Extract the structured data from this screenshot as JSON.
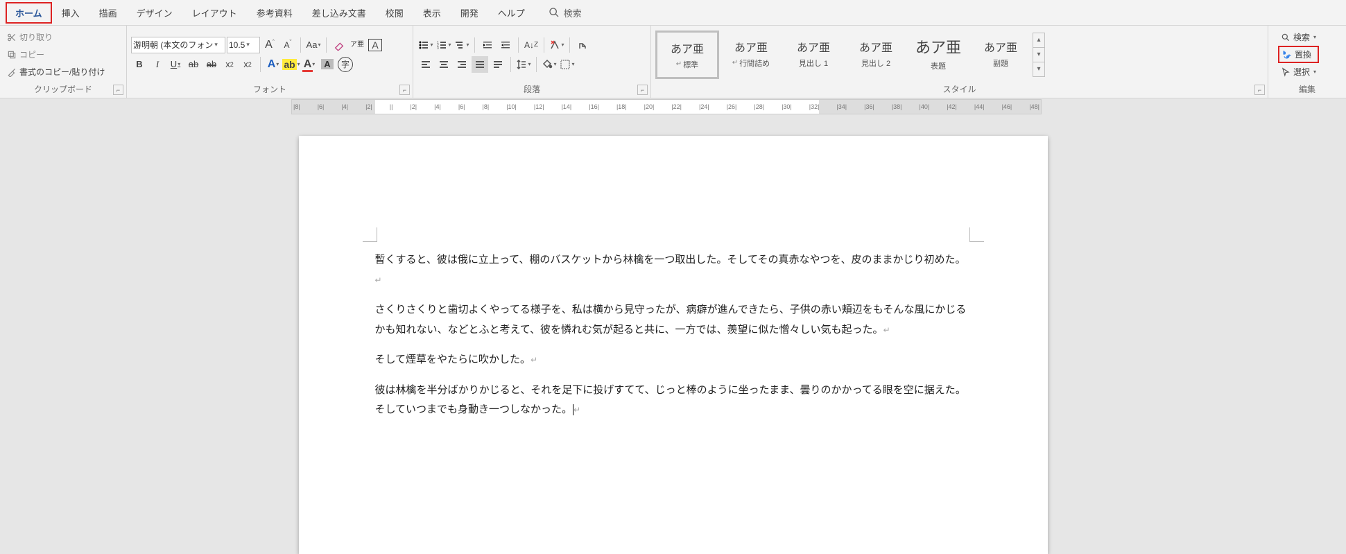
{
  "tabs": {
    "items": [
      "ホーム",
      "挿入",
      "描画",
      "デザイン",
      "レイアウト",
      "参考資料",
      "差し込み文書",
      "校閲",
      "表示",
      "開発",
      "ヘルプ"
    ],
    "search": "検索"
  },
  "clipboard": {
    "cut": "切り取り",
    "copy": "コピー",
    "format_painter": "書式のコピー/貼り付け",
    "label": "クリップボード"
  },
  "font": {
    "name": "游明朝 (本文のフォン",
    "size": "10.5",
    "label": "フォント",
    "ruby": "ア亜",
    "Aa": "Aa",
    "A_big": "A",
    "A_small": "A"
  },
  "paragraph": {
    "label": "段落"
  },
  "styles": {
    "label": "スタイル",
    "preview": "あア亜",
    "items": [
      {
        "cap": "標準",
        "sel": true,
        "ret": true,
        "big": false
      },
      {
        "cap": "行間詰め",
        "sel": false,
        "ret": true,
        "big": false
      },
      {
        "cap": "見出し 1",
        "sel": false,
        "ret": false,
        "big": false
      },
      {
        "cap": "見出し 2",
        "sel": false,
        "ret": false,
        "big": false
      },
      {
        "cap": "表題",
        "sel": false,
        "ret": false,
        "big": true
      },
      {
        "cap": "副題",
        "sel": false,
        "ret": false,
        "big": false
      }
    ]
  },
  "editing": {
    "label": "編集",
    "find": "検索",
    "replace": "置換",
    "select": "選択"
  },
  "ruler": [
    "8",
    "6",
    "4",
    "2",
    "",
    "2",
    "4",
    "6",
    "8",
    "10",
    "12",
    "14",
    "16",
    "18",
    "20",
    "22",
    "24",
    "26",
    "28",
    "30",
    "32",
    "34",
    "36",
    "38",
    "40",
    "42",
    "44",
    "46",
    "48"
  ],
  "doc": {
    "p1": "暫くすると、彼は俄に立上って、棚のバスケットから林檎を一つ取出した。そしてその真赤なやつを、皮のままかじり初めた。",
    "p2": "さくりさくりと歯切よくやってる様子を、私は横から見守ったが、病癖が進んできたら、子供の赤い頬辺をもそんな風にかじるかも知れない、などとふと考えて、彼を憐れむ気が起ると共に、一方では、羨望に似た憎々しい気も起った。",
    "p3": "そして煙草をやたらに吹かした。",
    "p4": "彼は林檎を半分ばかりかじると、それを足下に投げすてて、じっと棒のように坐ったまま、曇りのかかってる眼を空に据えた。そしていつまでも身動き一つしなかった。"
  }
}
